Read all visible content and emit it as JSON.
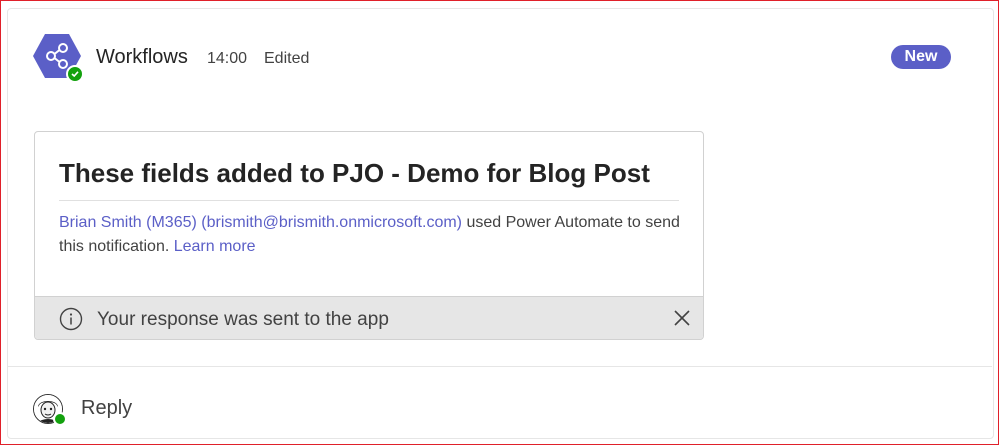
{
  "message": {
    "sender": "Workflows",
    "time": "14:00",
    "edited_label": "Edited",
    "new_badge": "New",
    "app_icon": "workflows-share-icon",
    "status": "available"
  },
  "card": {
    "title": "These fields added to PJO - Demo for Blog Post",
    "author_link": "Brian Smith (M365) (brismith@brismith.onmicrosoft.com)",
    "body_text_1": " used Power Automate to send this notification. ",
    "learn_more": "Learn more",
    "footer_text": "Your response was sent to the app"
  },
  "reply": {
    "label": "Reply"
  },
  "colors": {
    "accent": "#5b5fc7",
    "presence_green": "#13a10e",
    "frame_red": "#e0202a"
  }
}
